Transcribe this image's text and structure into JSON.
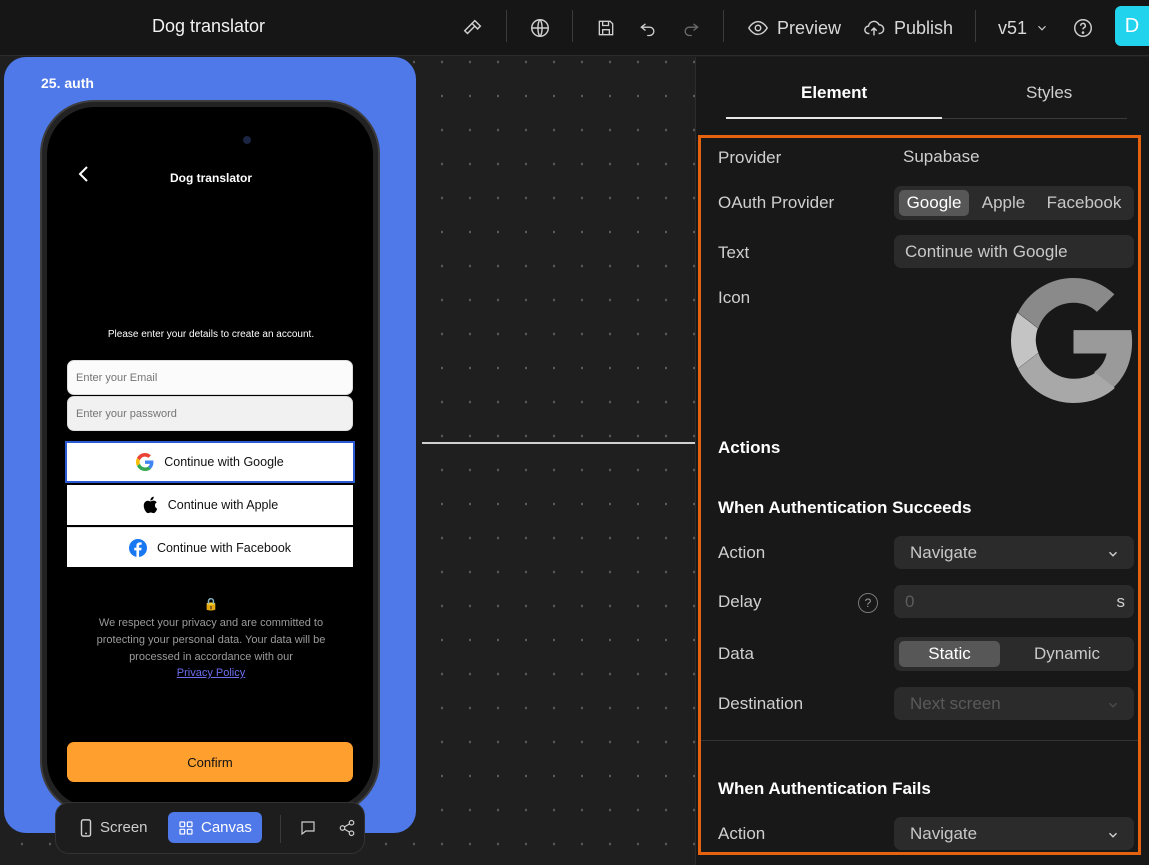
{
  "topbar": {
    "title": "Dog translator",
    "preview_label": "Preview",
    "publish_label": "Publish",
    "version": "v51",
    "user_initial": "D",
    "accent_color": "#22d3ee"
  },
  "canvas": {
    "frame_label": "25. auth",
    "frame_color": "#4f78e8",
    "app": {
      "title": "Dog translator",
      "prompt": "Please enter your details to create an account.",
      "email_placeholder": "Enter your Email",
      "password_placeholder": "Enter your password",
      "google_label": "Continue with Google",
      "apple_label": "Continue with Apple",
      "facebook_label": "Continue with Facebook",
      "lock_icon": "🔒",
      "privacy_text": "We respect your privacy and are committed to protecting your personal data. Your data will be processed in accordance with our",
      "privacy_link": "Privacy Policy",
      "confirm_label": "Confirm",
      "confirm_color": "#ff9f2e"
    },
    "toolbar": {
      "screen_label": "Screen",
      "canvas_label": "Canvas"
    }
  },
  "panel": {
    "tabs": [
      "Element",
      "Styles"
    ],
    "provider_label": "Provider",
    "provider_value": "Supabase",
    "oauth_label": "OAuth Provider",
    "oauth_options": [
      "Google",
      "Apple",
      "Facebook"
    ],
    "oauth_selected": "Google",
    "text_label": "Text",
    "text_value": "Continue with Google",
    "icon_label": "Icon",
    "actions_heading": "Actions",
    "success_heading": "When Authentication Succeeds",
    "action_label": "Action",
    "action_value": "Navigate",
    "delay_label": "Delay",
    "delay_value": "0",
    "delay_unit": "s",
    "data_label": "Data",
    "data_options": [
      "Static",
      "Dynamic"
    ],
    "data_selected": "Static",
    "destination_label": "Destination",
    "destination_value": "Next screen",
    "fails_heading": "When Authentication Fails",
    "fail_action_label": "Action",
    "fail_action_value": "Navigate",
    "highlight_color": "#e5620e"
  }
}
